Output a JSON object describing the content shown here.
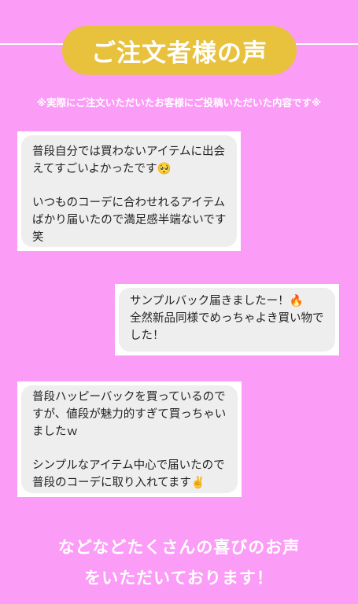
{
  "header": {
    "title": "ご注文者様の声",
    "note": "※実際にご注文いただいたお客様にご投稿いただいた内容です※"
  },
  "reviews": [
    {
      "paragraphs": [
        "普段自分では買わないアイテムに出会\nえてすごいよかったです🥺",
        "いつものコーデに合わせれるアイテム\nばかり届いたので満足感半端ないです\n笑"
      ]
    },
    {
      "paragraphs": [
        "サンプルバック届きましたー！🔥\n全然新品同様でめっちゃよき買い物で\nした！"
      ]
    },
    {
      "paragraphs": [
        "普段ハッピーバックを買っているので\nすが、値段が魅力的すぎて買っちゃい\nましたｗ",
        "シンプルなアイテム中心で届いたので\n普段のコーデに取り入れてます✌️"
      ]
    }
  ],
  "closing": {
    "line1": "などなどたくさんの喜びのお声",
    "line2": "をいただいております！"
  },
  "colors": {
    "background": "#fb9cf6",
    "title_pill": "#e8c13d",
    "bubble": "#eeeeee",
    "card": "#ffffff"
  }
}
